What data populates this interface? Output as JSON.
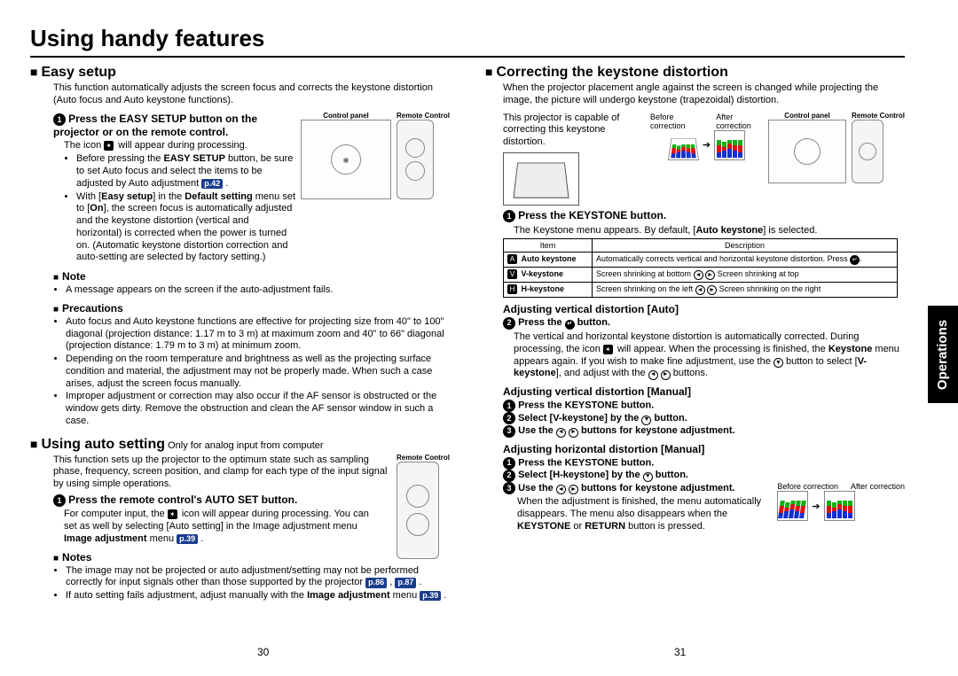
{
  "title": "Using handy features",
  "side_tab": "Operations",
  "page_left": "30",
  "page_right": "31",
  "left": {
    "easy_setup": {
      "heading": "Easy setup",
      "intro": "This function automatically adjusts the screen focus and corrects the keystone distortion (Auto focus and Auto keystone functions).",
      "step1_title": "Press the EASY SETUP button on the projector or on the remote control.",
      "step1_line1_pre": "The icon ",
      "step1_line1_post": " will appear during processing.",
      "bullets": [
        "Before pressing the EASY SETUP button, be sure to set Auto focus and select the items to be adjusted by Auto adjustment p.42 .",
        "With [Easy setup] in the Default setting menu set to [On], the screen focus is automatically adjusted and the keystone distortion (vertical and horizontal) is corrected when the power is turned on. (Automatic keystone distortion correction and auto-setting are selected by factory setting.)"
      ],
      "note_heading": "Note",
      "note_bullet": "A message appears on the screen if the auto-adjustment fails.",
      "precautions_heading": "Precautions",
      "precautions": [
        "Auto focus and Auto keystone functions are effective for projecting size from 40\" to 100\" diagonal (projection distance: 1.17 m to 3 m) at maximum zoom and 40\" to 66\" diagonal (projection distance: 1.79 m to 3 m) at minimum zoom.",
        "Depending on the room temperature and brightness as well as the projecting surface condition and material, the adjustment may not be properly made. When such a case arises, adjust the screen focus manually.",
        "Improper adjustment or correction may also occur if the AF sensor is obstructed or the window gets dirty. Remove the obstruction and clean the AF sensor window in such a case."
      ],
      "fig_control_panel": "Control panel",
      "fig_remote": "Remote Control"
    },
    "auto_setting": {
      "heading": "Using auto setting",
      "heading_sub": " Only for analog input from computer",
      "intro": "This function sets up the projector to the optimum state such as sampling phase, frequency, screen position, and clamp for each type of the input signal by using simple operations.",
      "step1_title": "Press the remote control's AUTO SET button.",
      "step1_body_pre": "For computer input, the ",
      "step1_body_mid": " icon will appear during processing. You can set as well by selecting [Auto setting] in the Image adjustment menu ",
      "step1_body_post": " .",
      "p39": "p.39",
      "notes_heading": "Notes",
      "notes": [
        "The image may not be projected or auto adjustment/setting may not be performed correctly for input signals other than those supported by the projector p.86 , p.87 .",
        "If auto setting fails adjustment, adjust manually with the Image adjustment menu p.39 ."
      ],
      "fig_remote": "Remote Control"
    }
  },
  "right": {
    "heading": "Correcting the keystone distortion",
    "intro": "When the projector placement angle against the screen is changed while projecting the image, the picture will undergo keystone (trapezoidal) distortion.",
    "cap_line": "This projector is capable of correcting this keystone distortion.",
    "before_label": "Before correction",
    "after_label": "After correction",
    "fig_control_panel": "Control panel",
    "fig_remote": "Remote Control",
    "step1_title": "Press the KEYSTONE button.",
    "step1_body_pre": "The Keystone menu appears. By default, [",
    "step1_body_bold": "Auto keystone",
    "step1_body_post": "] is selected.",
    "table": {
      "h1": "Item",
      "h2": "Description",
      "r1_item": "Auto keystone",
      "r1_desc_pre": "Automatically corrects vertical and horizontal keystone distortion. Press ",
      "r1_desc_post": ".",
      "r2_item": "V-keystone",
      "r2_desc_left": "Screen shrinking at bottom",
      "r2_desc_right": "Screen shrinking at top",
      "r3_item": "H-keystone",
      "r3_desc_left": "Screen shrinking on the left",
      "r3_desc_right": "Screen shrinking on the right"
    },
    "adj_v_auto": "Adjusting vertical distortion [Auto]",
    "step2_title_pre": "Press the ",
    "step2_title_post": " button.",
    "step2_body": "The vertical and horizontal keystone distortion is automatically corrected. During processing, the icon  will appear. When the processing is finished, the Keystone menu appears again. If you wish to make fine adjustment, use the  button to select [V-keystone], and adjust with the  buttons.",
    "adj_v_manual": "Adjusting vertical distortion [Manual]",
    "m1": "Press the KEYSTONE button.",
    "m2_pre": "Select [V-keystone] by the ",
    "m2_post": " button.",
    "m3_pre": "Use the ",
    "m3_post": " buttons for keystone adjustment.",
    "adj_h_manual": "Adjusting horizontal distortion [Manual]",
    "h1": "Press the KEYSTONE button.",
    "h2_pre": "Select [H-keystone] by the ",
    "h2_post": " button.",
    "h3_pre": "Use the ",
    "h3_post": " buttons for keystone adjustment.",
    "finish_body": "When the adjustment is finished, the menu automatically disappears. The menu also disappears when the KEYSTONE or RETURN button is pressed.",
    "before_label2": "Before correction",
    "after_label2": "After correction"
  },
  "chart_data": [
    {
      "type": "bar",
      "title": "Before correction (top)",
      "categories": [
        "1",
        "2",
        "3",
        "4",
        "5"
      ],
      "series": [
        {
          "name": "blue",
          "values": [
            3,
            4,
            5,
            4,
            3
          ],
          "color": "#1030d0"
        },
        {
          "name": "red",
          "values": [
            4,
            2,
            3,
            3,
            4
          ],
          "color": "#e01010"
        },
        {
          "name": "green",
          "values": [
            3,
            3,
            2,
            3,
            3
          ],
          "color": "#10b010"
        }
      ]
    },
    {
      "type": "bar",
      "title": "After correction (top)",
      "categories": [
        "1",
        "2",
        "3",
        "4",
        "5"
      ],
      "series": [
        {
          "name": "blue",
          "values": [
            3,
            4,
            5,
            4,
            3
          ],
          "color": "#1030d0"
        },
        {
          "name": "red",
          "values": [
            4,
            2,
            3,
            3,
            4
          ],
          "color": "#e01010"
        },
        {
          "name": "green",
          "values": [
            3,
            3,
            2,
            3,
            3
          ],
          "color": "#10b010"
        }
      ]
    }
  ]
}
